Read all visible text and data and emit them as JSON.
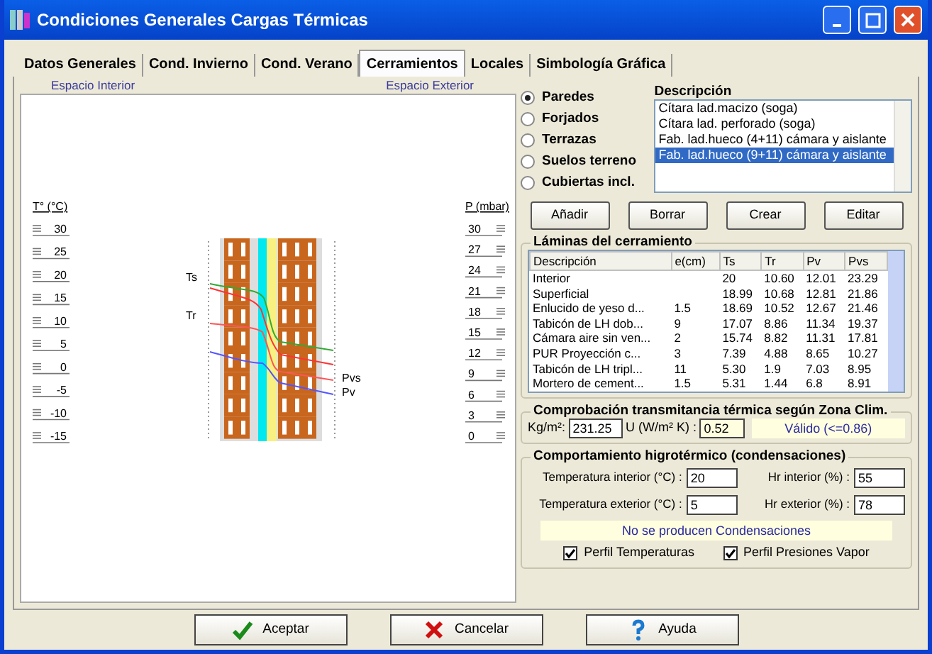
{
  "window": {
    "title": "Condiciones Generales Cargas Térmicas"
  },
  "tabs": [
    {
      "label": "Datos Generales",
      "selected": false
    },
    {
      "label": "Cond. Invierno",
      "selected": false
    },
    {
      "label": "Cond. Verano",
      "selected": false
    },
    {
      "label": "Cerramientos",
      "selected": true
    },
    {
      "label": "Locales",
      "selected": false
    },
    {
      "label": "Simbología Gráfica",
      "selected": false
    }
  ],
  "diagram": {
    "interior_label": "Espacio Interior",
    "exterior_label": "Espacio Exterior",
    "temperature_axis": {
      "title": "T° (°C)",
      "labels": [
        "30",
        "25",
        "20",
        "15",
        "10",
        "5",
        "0",
        "-5",
        "-10",
        "-15"
      ]
    },
    "pressure_axis": {
      "title": "P (mbar)",
      "labels": [
        "30",
        "27",
        "24",
        "21",
        "18",
        "15",
        "12",
        "9",
        "6",
        "3",
        "0"
      ]
    },
    "curve_labels": [
      "Ts",
      "Tr",
      "Pvs",
      "Pv"
    ]
  },
  "types": [
    {
      "label": "Paredes",
      "selected": true
    },
    {
      "label": "Forjados",
      "selected": false
    },
    {
      "label": "Terrazas",
      "selected": false
    },
    {
      "label": "Suelos terreno",
      "selected": false
    },
    {
      "label": "Cubiertas incl.",
      "selected": false
    }
  ],
  "description_list": {
    "header": "Descripción",
    "items": [
      {
        "label": "Cítara lad.macizo (soga)",
        "selected": false
      },
      {
        "label": "Cítara lad. perforado (soga)",
        "selected": false
      },
      {
        "label": "Fab. lad.hueco (4+11) cámara y aislante",
        "selected": false
      },
      {
        "label": "Fab. lad.hueco (9+11) cámara y aislante",
        "selected": true
      }
    ]
  },
  "action_buttons": [
    "Añadir",
    "Borrar",
    "Crear",
    "Editar"
  ],
  "layers": {
    "title": "Láminas del cerramiento",
    "columns": [
      "Descripción",
      "e(cm)",
      "Ts",
      "Tr",
      "Pv",
      "Pvs"
    ],
    "rows": [
      [
        "Interior",
        null,
        "20",
        "10.60",
        "12.01",
        "23.29"
      ],
      [
        "Superficial",
        null,
        "18.99",
        "10.68",
        "12.81",
        "21.86"
      ],
      [
        "Enlucido de yeso d...",
        "1.5",
        "18.69",
        "10.52",
        "12.67",
        "21.46"
      ],
      [
        "Tabicón de LH dob...",
        "9",
        "17.07",
        "8.86",
        "11.34",
        "19.37"
      ],
      [
        "Cámara aire sin ven...",
        "2",
        "15.74",
        "8.82",
        "11.31",
        "17.81"
      ],
      [
        "PUR Proyección c...",
        "3",
        "7.39",
        "4.88",
        "8.65",
        "10.27"
      ],
      [
        "Tabicón de LH tripl...",
        "11",
        "5.30",
        "1.9",
        "7.03",
        "8.95"
      ],
      [
        "Mortero de cement...",
        "1.5",
        "5.31",
        "1.44",
        "6.8",
        "8.91"
      ]
    ]
  },
  "transmittance": {
    "title": "Comprobación transmitancia térmica según Zona Clim.",
    "weight_label": "Kg/m²:",
    "weight": "231.25",
    "u_label": "U (W/m² K) :",
    "u": "0.52",
    "status": "Válido (<=0.86)"
  },
  "hygrothermal": {
    "title": "Comportamiento higrotérmico (condensaciones)",
    "fields": [
      {
        "label": "Temperatura interior (°C) :",
        "value": "20"
      },
      {
        "label": "Hr interior (%) :",
        "value": "55"
      },
      {
        "label": "Temperatura exterior (°C) :",
        "value": "5"
      },
      {
        "label": "Hr exterior (%) :",
        "value": "78"
      }
    ],
    "status": "No se producen Condensaciones",
    "checkboxes": [
      {
        "label": "Perfil Temperaturas",
        "checked": true
      },
      {
        "label": "Perfil Presiones Vapor",
        "checked": true
      }
    ]
  },
  "footer_buttons": [
    {
      "label": "Aceptar",
      "kind": "ok"
    },
    {
      "label": "Cancelar",
      "kind": "cancel"
    },
    {
      "label": "Ayuda",
      "kind": "help"
    }
  ]
}
